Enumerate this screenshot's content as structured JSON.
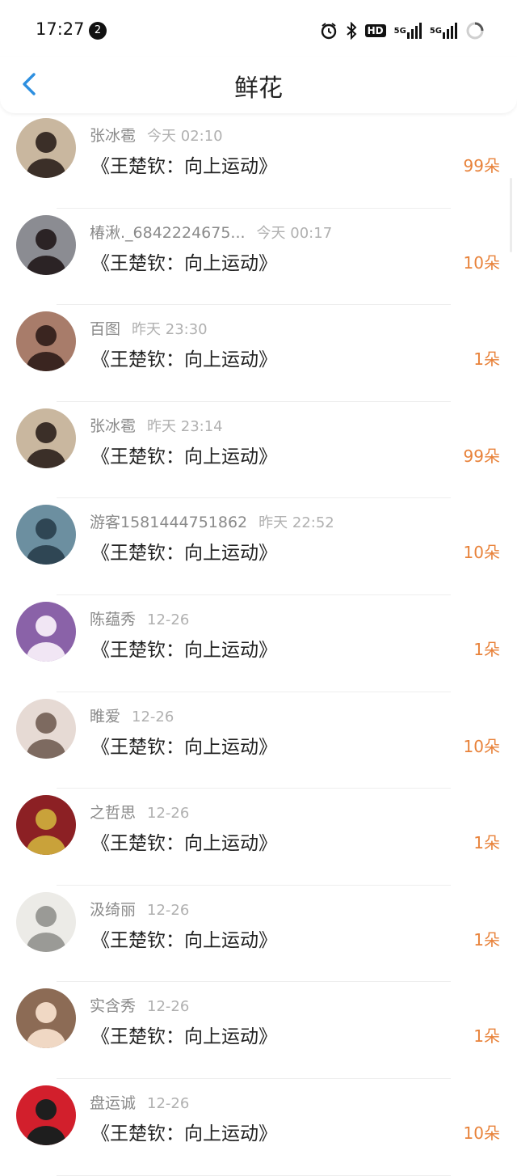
{
  "status_bar": {
    "time": "17:27",
    "notification_count": "2",
    "hd_label": "HD",
    "network_1": "5G",
    "network_2": "5G"
  },
  "header": {
    "title": "鲜花"
  },
  "colors": {
    "accent": "#e8823a",
    "back": "#2d8fe0"
  },
  "rows": [
    {
      "user": "张冰雹",
      "time": "今天 02:10",
      "book": "《王楚钦：向上运动》",
      "amount": "99朵",
      "avatar": {
        "bg": "#c9b79f",
        "fg": "#3b2f28"
      }
    },
    {
      "user": "椿湫._6842224675...",
      "time": "今天 00:17",
      "book": "《王楚钦：向上运动》",
      "amount": "10朵",
      "avatar": {
        "bg": "#8b8c92",
        "fg": "#2b2325"
      }
    },
    {
      "user": "百图",
      "time": "昨天 23:30",
      "book": "《王楚钦：向上运动》",
      "amount": "1朵",
      "avatar": {
        "bg": "#a87c6a",
        "fg": "#3a2520"
      }
    },
    {
      "user": "张冰雹",
      "time": "昨天 23:14",
      "book": "《王楚钦：向上运动》",
      "amount": "99朵",
      "avatar": {
        "bg": "#c9b79f",
        "fg": "#3b2f28"
      }
    },
    {
      "user": "游客1581444751862",
      "time": "昨天 22:52",
      "book": "《王楚钦：向上运动》",
      "amount": "10朵",
      "avatar": {
        "bg": "#6c8fa0",
        "fg": "#2f4654"
      }
    },
    {
      "user": "陈蕴秀",
      "time": "12-26",
      "book": "《王楚钦：向上运动》",
      "amount": "1朵",
      "avatar": {
        "bg": "#8a62a8",
        "fg": "#f1e6f4"
      }
    },
    {
      "user": "睢爱",
      "time": "12-26",
      "book": "《王楚钦：向上运动》",
      "amount": "10朵",
      "avatar": {
        "bg": "#e6dad4",
        "fg": "#7d6a60"
      }
    },
    {
      "user": "之哲思",
      "time": "12-26",
      "book": "《王楚钦：向上运动》",
      "amount": "1朵",
      "avatar": {
        "bg": "#8c2024",
        "fg": "#c9a23a"
      }
    },
    {
      "user": "汲绮丽",
      "time": "12-26",
      "book": "《王楚钦：向上运动》",
      "amount": "1朵",
      "avatar": {
        "bg": "#ecebe7",
        "fg": "#9a9a96"
      }
    },
    {
      "user": "实含秀",
      "time": "12-26",
      "book": "《王楚钦：向上运动》",
      "amount": "1朵",
      "avatar": {
        "bg": "#8c6b55",
        "fg": "#f0d8c4"
      }
    },
    {
      "user": "盘运诚",
      "time": "12-26",
      "book": "《王楚钦：向上运动》",
      "amount": "10朵",
      "avatar": {
        "bg": "#d21f2c",
        "fg": "#1e1e1e"
      }
    }
  ]
}
